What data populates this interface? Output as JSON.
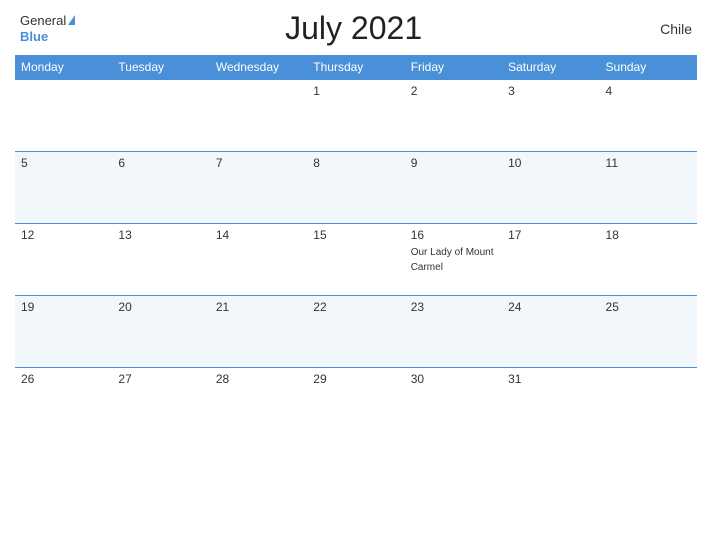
{
  "header": {
    "logo_general": "General",
    "logo_blue": "Blue",
    "title": "July 2021",
    "country": "Chile"
  },
  "weekdays": [
    "Monday",
    "Tuesday",
    "Wednesday",
    "Thursday",
    "Friday",
    "Saturday",
    "Sunday"
  ],
  "weeks": [
    [
      {
        "day": "",
        "holiday": ""
      },
      {
        "day": "",
        "holiday": ""
      },
      {
        "day": "",
        "holiday": ""
      },
      {
        "day": "1",
        "holiday": ""
      },
      {
        "day": "2",
        "holiday": ""
      },
      {
        "day": "3",
        "holiday": ""
      },
      {
        "day": "4",
        "holiday": ""
      }
    ],
    [
      {
        "day": "5",
        "holiday": ""
      },
      {
        "day": "6",
        "holiday": ""
      },
      {
        "day": "7",
        "holiday": ""
      },
      {
        "day": "8",
        "holiday": ""
      },
      {
        "day": "9",
        "holiday": ""
      },
      {
        "day": "10",
        "holiday": ""
      },
      {
        "day": "11",
        "holiday": ""
      }
    ],
    [
      {
        "day": "12",
        "holiday": ""
      },
      {
        "day": "13",
        "holiday": ""
      },
      {
        "day": "14",
        "holiday": ""
      },
      {
        "day": "15",
        "holiday": ""
      },
      {
        "day": "16",
        "holiday": "Our Lady of Mount Carmel"
      },
      {
        "day": "17",
        "holiday": ""
      },
      {
        "day": "18",
        "holiday": ""
      }
    ],
    [
      {
        "day": "19",
        "holiday": ""
      },
      {
        "day": "20",
        "holiday": ""
      },
      {
        "day": "21",
        "holiday": ""
      },
      {
        "day": "22",
        "holiday": ""
      },
      {
        "day": "23",
        "holiday": ""
      },
      {
        "day": "24",
        "holiday": ""
      },
      {
        "day": "25",
        "holiday": ""
      }
    ],
    [
      {
        "day": "26",
        "holiday": ""
      },
      {
        "day": "27",
        "holiday": ""
      },
      {
        "day": "28",
        "holiday": ""
      },
      {
        "day": "29",
        "holiday": ""
      },
      {
        "day": "30",
        "holiday": ""
      },
      {
        "day": "31",
        "holiday": ""
      },
      {
        "day": "",
        "holiday": ""
      }
    ]
  ]
}
